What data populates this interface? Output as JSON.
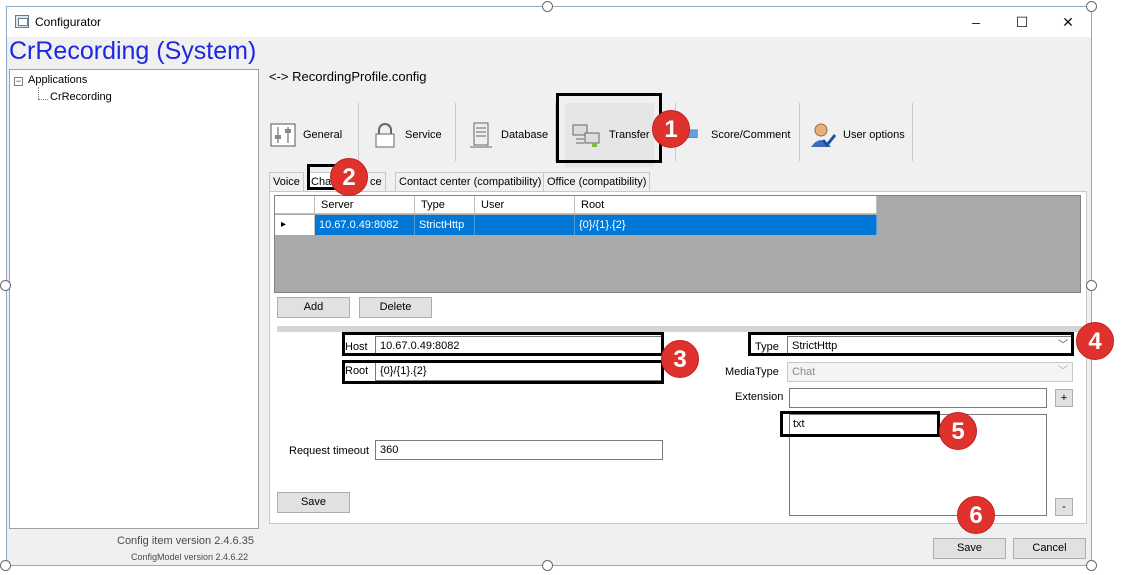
{
  "window": {
    "title": "Configurator",
    "controls": {
      "minimize": "–",
      "maximize": "☐",
      "close": "✕"
    },
    "app_heading": "CrRecording (System)"
  },
  "tree": {
    "expander": "−",
    "root": "Applications",
    "child": "CrRecording"
  },
  "footer": {
    "config_item_version": "Config item version 2.4.6.35",
    "config_model_version": "ConfigModel version 2.4.6.22",
    "save_label": "Save",
    "cancel_label": "Cancel"
  },
  "breadcrumb": "<-> RecordingProfile.config",
  "top_tabs": [
    {
      "label": "General",
      "icon": "sliders-icon"
    },
    {
      "label": "Service",
      "icon": "lock-icon"
    },
    {
      "label": "Database",
      "icon": "server-icon"
    },
    {
      "label": "Transfer",
      "icon": "network-transfer-icon"
    },
    {
      "label": "Score/Comment",
      "icon": "comment-icon"
    },
    {
      "label": "User options",
      "icon": "user-check-icon"
    }
  ],
  "sub_tabs": [
    "Voice",
    "Chat",
    "ce",
    "Contact center (compatibility)",
    "Office (compatibility)"
  ],
  "grid": {
    "columns": [
      "Server",
      "Type",
      "User",
      "Root"
    ],
    "rows": [
      {
        "server": "10.67.0.49:8082",
        "type": "StrictHttp",
        "user": "",
        "root": "{0}/{1}.{2}"
      }
    ],
    "row_indicator": "▸"
  },
  "buttons": {
    "add": "Add",
    "delete": "Delete",
    "save": "Save",
    "ext_add": "+",
    "ext_remove": "-"
  },
  "form": {
    "host_label": "Host",
    "host_value": "10.67.0.49:8082",
    "root_label": "Root",
    "root_value": "{0}/{1}.{2}",
    "request_timeout_label": "Request timeout",
    "request_timeout_value": "360",
    "type_label": "Type",
    "type_value": "StrictHttp",
    "media_type_label": "MediaType",
    "media_type_value": "Chat",
    "extension_label": "Extension",
    "extension_value": "",
    "extensions_list": [
      "txt"
    ]
  },
  "annotations": [
    "1",
    "2",
    "3",
    "4",
    "5",
    "6"
  ],
  "colors": {
    "heading": "#1d28e0",
    "selection": "#0078d7",
    "badge": "#e0322d"
  }
}
